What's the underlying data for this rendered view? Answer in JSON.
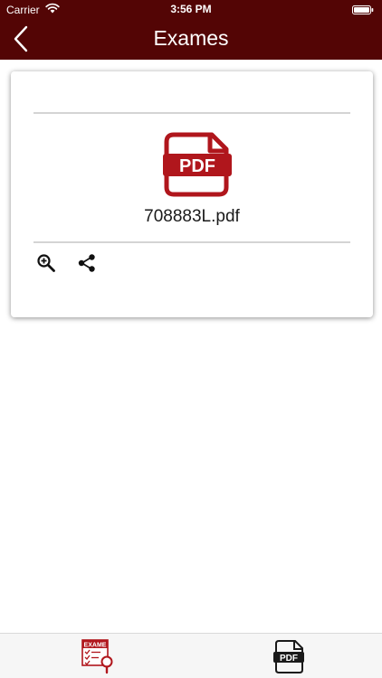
{
  "status_bar": {
    "carrier": "Carrier",
    "time": "3:56 PM"
  },
  "nav": {
    "title": "Exames",
    "back_icon": "chevron-left-icon"
  },
  "exam_card": {
    "file_icon": "pdf-file-icon",
    "file_icon_text": "PDF",
    "file_name": "708883L.pdf",
    "actions": [
      {
        "icon": "zoom-in-icon"
      },
      {
        "icon": "share-icon"
      }
    ]
  },
  "tab_bar": {
    "tabs": [
      {
        "icon": "exam-form-icon",
        "icon_text": "EXAME",
        "active": true
      },
      {
        "icon": "pdf-file-icon",
        "icon_text": "PDF",
        "active": false
      }
    ]
  },
  "colors": {
    "header_bg": "#530505",
    "accent_red": "#b0161c",
    "divider": "#d4d4d4"
  }
}
